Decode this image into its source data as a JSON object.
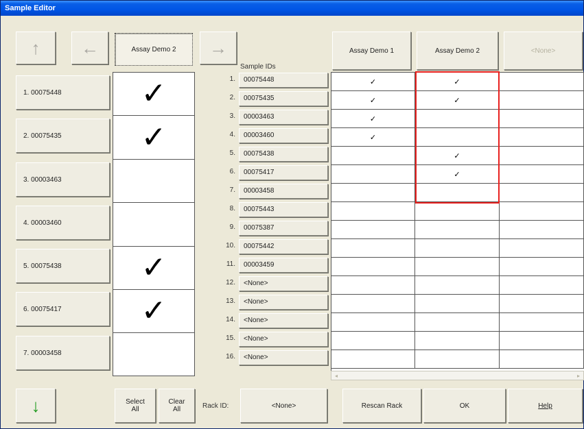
{
  "window": {
    "title": "Sample Editor"
  },
  "nav": {
    "up_icon": "up-arrow-icon",
    "left_icon": "left-arrow-icon",
    "right_icon": "right-arrow-icon",
    "down_icon": "down-arrow-icon",
    "current_assay": "Assay Demo 2"
  },
  "sample_ids_header": "Sample IDs",
  "assays": [
    "Assay Demo 1",
    "Assay Demo 2",
    "<None>"
  ],
  "samples": [
    {
      "num": "1.",
      "id": "00075448",
      "label": "1. 00075448",
      "checked": true
    },
    {
      "num": "2.",
      "id": "00075435",
      "label": "2. 00075435",
      "checked": true
    },
    {
      "num": "3.",
      "id": "00003463",
      "label": "3. 00003463",
      "checked": false
    },
    {
      "num": "4.",
      "id": "00003460",
      "label": "4. 00003460",
      "checked": false
    },
    {
      "num": "5.",
      "id": "00075438",
      "label": "5. 00075438",
      "checked": true
    },
    {
      "num": "6.",
      "id": "00075417",
      "label": "6. 00075417",
      "checked": true
    },
    {
      "num": "7.",
      "id": "00003458",
      "label": "7. 00003458",
      "checked": false
    }
  ],
  "rack_rows": [
    {
      "num": "1.",
      "id": "00075448",
      "a1": "✓",
      "a2": "✓",
      "a3": ""
    },
    {
      "num": "2.",
      "id": "00075435",
      "a1": "✓",
      "a2": "✓",
      "a3": ""
    },
    {
      "num": "3.",
      "id": "00003463",
      "a1": "✓",
      "a2": "",
      "a3": ""
    },
    {
      "num": "4.",
      "id": "00003460",
      "a1": "✓",
      "a2": "",
      "a3": ""
    },
    {
      "num": "5.",
      "id": "00075438",
      "a1": "",
      "a2": "✓",
      "a3": ""
    },
    {
      "num": "6.",
      "id": "00075417",
      "a1": "",
      "a2": "✓",
      "a3": ""
    },
    {
      "num": "7.",
      "id": "00003458",
      "a1": "",
      "a2": "",
      "a3": ""
    },
    {
      "num": "8.",
      "id": "00075443",
      "a1": "",
      "a2": "",
      "a3": ""
    },
    {
      "num": "9.",
      "id": "00075387",
      "a1": "",
      "a2": "",
      "a3": ""
    },
    {
      "num": "10.",
      "id": "00075442",
      "a1": "",
      "a2": "",
      "a3": ""
    },
    {
      "num": "11.",
      "id": "00003459",
      "a1": "",
      "a2": "",
      "a3": ""
    },
    {
      "num": "12.",
      "id": "<None>",
      "a1": "",
      "a2": "",
      "a3": ""
    },
    {
      "num": "13.",
      "id": "<None>",
      "a1": "",
      "a2": "",
      "a3": ""
    },
    {
      "num": "14.",
      "id": "<None>",
      "a1": "",
      "a2": "",
      "a3": ""
    },
    {
      "num": "15.",
      "id": "<None>",
      "a1": "",
      "a2": "",
      "a3": ""
    },
    {
      "num": "16.",
      "id": "<None>",
      "a1": "",
      "a2": "",
      "a3": ""
    }
  ],
  "footer": {
    "select_all": "Select All",
    "clear_all": "Clear All",
    "rack_id_label": "Rack ID:",
    "rack_id_value": "<None>",
    "rescan": "Rescan Rack",
    "ok": "OK",
    "help": "Help"
  },
  "colors": {
    "highlight": "#e8211f",
    "titlebar": "#0055e5",
    "down_arrow": "#1f9a1f"
  }
}
